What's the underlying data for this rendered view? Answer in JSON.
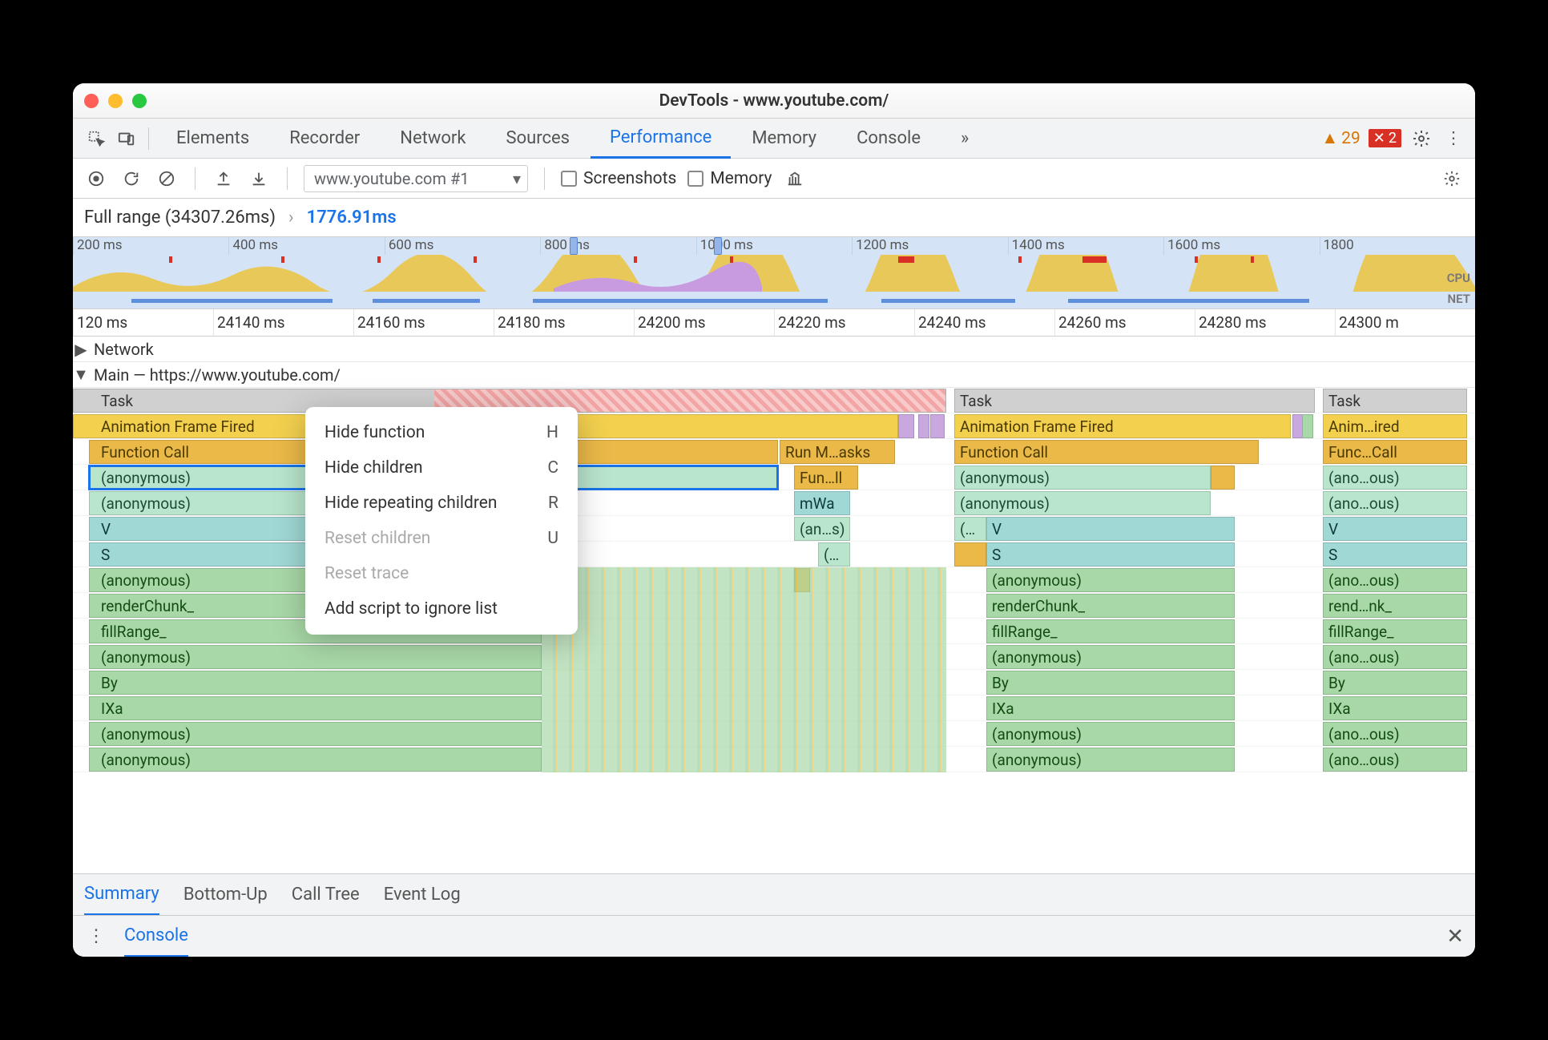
{
  "window": {
    "title": "DevTools - www.youtube.com/"
  },
  "mainTabs": [
    "Elements",
    "Recorder",
    "Network",
    "Sources",
    "Performance",
    "Memory",
    "Console"
  ],
  "mainTabActive": "Performance",
  "mainTabsOverflow": "»",
  "warnings": "29",
  "errors": "2",
  "perfBar": {
    "recordingSelect": "www.youtube.com #1",
    "screenshotsLabel": "Screenshots",
    "memoryLabel": "Memory"
  },
  "breadcrumb": {
    "full": "Full range (34307.26ms)",
    "chev": "›",
    "selected": "1776.91ms"
  },
  "overviewTicks": [
    "200 ms",
    "400 ms",
    "600 ms",
    "800 ms",
    "1000 ms",
    "1200 ms",
    "1400 ms",
    "1600 ms",
    "1800"
  ],
  "overviewLabels": {
    "cpu": "CPU",
    "net": "NET"
  },
  "detailTicks": [
    "120 ms",
    "24140 ms",
    "24160 ms",
    "24180 ms",
    "24200 ms",
    "24220 ms",
    "24240 ms",
    "24260 ms",
    "24280 ms",
    "24300 m"
  ],
  "trackHeaders": {
    "network": "Network",
    "main": "Main — https://www.youtube.com/"
  },
  "flameCol1": {
    "task": "Task",
    "aff": "Animation Frame Fired",
    "fc": "Function Call",
    "run": "Run M…asks",
    "an1": "(anonymous)",
    "fun": "Fun…ll",
    "an2": "(anonymous)",
    "mwa": "mWa",
    "v": "V",
    "ans": "(an…s)",
    "s": "S",
    "dots": "(…",
    "an3": "(anonymous)",
    "rc": "renderChunk_",
    "fr": "fillRange_",
    "an4": "(anonymous)",
    "by": "By",
    "ixa": "IXa",
    "an5": "(anonymous)",
    "an6": "(anonymous)"
  },
  "flameCol2": {
    "task": "Task",
    "aff": "Animation Frame Fired",
    "fc": "Function Call",
    "an1": "(anonymous)",
    "an2": "(anonymous)",
    "dots": "(…",
    "v": "V",
    "s": "S",
    "an3": "(anonymous)",
    "rc": "renderChunk_",
    "fr": "fillRange_",
    "an4": "(anonymous)",
    "by": "By",
    "ixa": "IXa",
    "an5": "(anonymous)",
    "an6": "(anonymous)"
  },
  "flameCol3": {
    "task": "Task",
    "aff": "Anim…ired",
    "fc": "Func…Call",
    "an1": "(ano…ous)",
    "an2": "(ano…ous)",
    "v": "V",
    "s": "S",
    "an3": "(ano…ous)",
    "rc": "rend…nk_",
    "fr": "fillRange_",
    "an4": "(ano…ous)",
    "by": "By",
    "ixa": "IXa",
    "an5": "(ano…ous)",
    "an6": "(ano…ous)"
  },
  "contextMenu": [
    {
      "label": "Hide function",
      "shortcut": "H",
      "disabled": false
    },
    {
      "label": "Hide children",
      "shortcut": "C",
      "disabled": false
    },
    {
      "label": "Hide repeating children",
      "shortcut": "R",
      "disabled": false
    },
    {
      "label": "Reset children",
      "shortcut": "U",
      "disabled": true
    },
    {
      "label": "Reset trace",
      "shortcut": "",
      "disabled": true
    },
    {
      "label": "Add script to ignore list",
      "shortcut": "",
      "disabled": false
    }
  ],
  "bottomTabs": [
    "Summary",
    "Bottom-Up",
    "Call Tree",
    "Event Log"
  ],
  "bottomTabActive": "Summary",
  "drawer": {
    "tab": "Console"
  }
}
